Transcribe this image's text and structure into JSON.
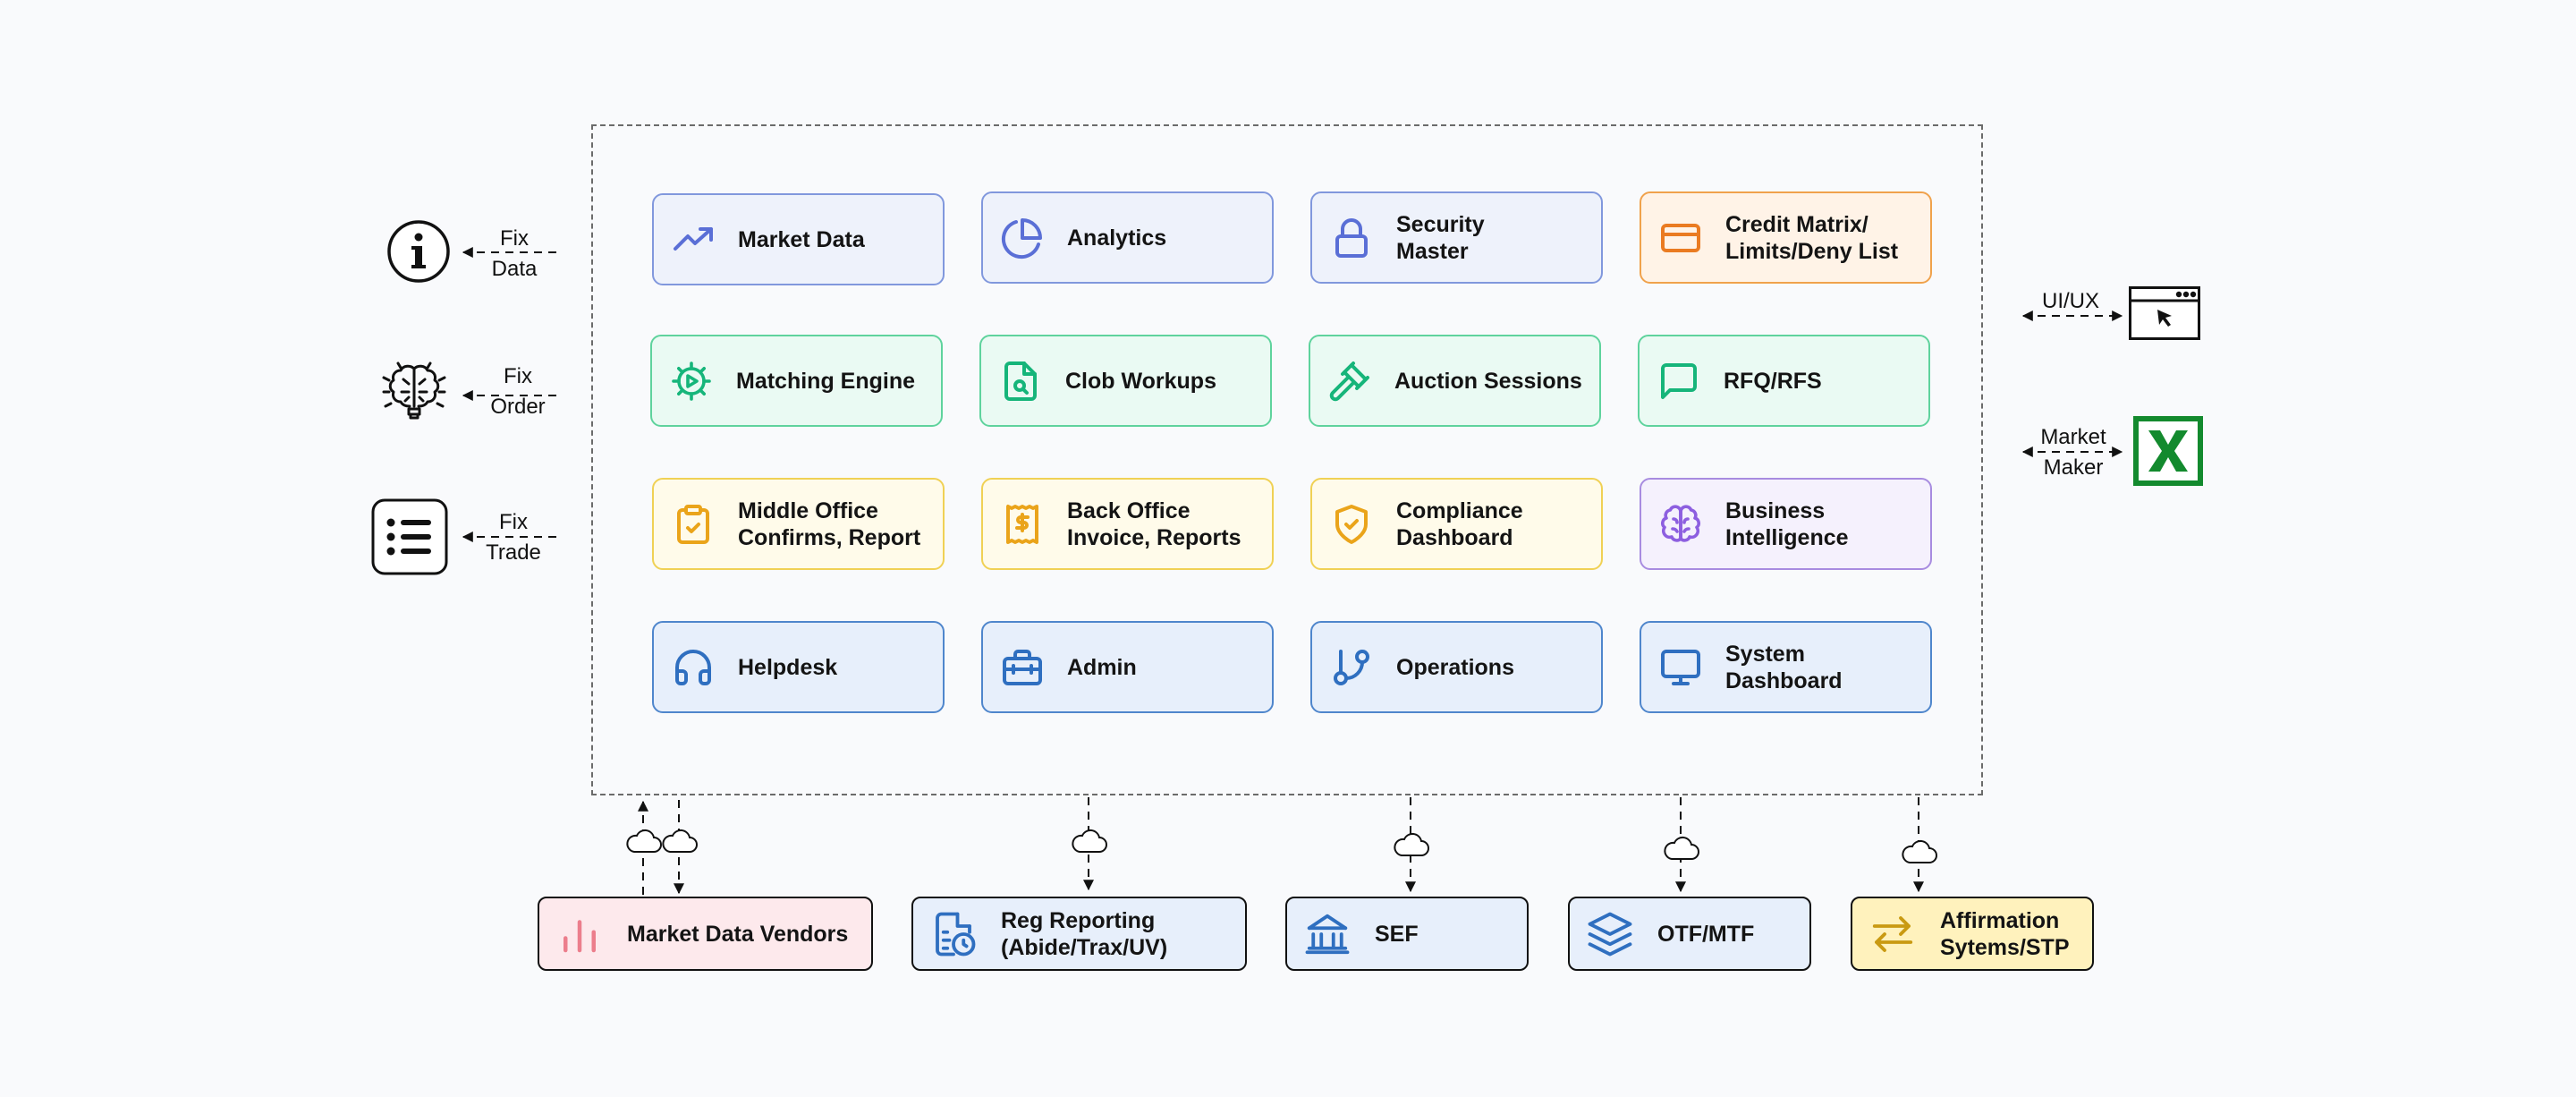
{
  "modules": [
    {
      "id": "market-data",
      "label": "Market Data",
      "icon": "trending-up-icon",
      "color": "#5a6fd6"
    },
    {
      "id": "analytics",
      "label": "Analytics",
      "icon": "pie-chart-icon",
      "color": "#5a6fd6"
    },
    {
      "id": "security-master",
      "label": "Security\nMaster",
      "icon": "lock-icon",
      "color": "#5a6fd6"
    },
    {
      "id": "credit-matrix",
      "label": "Credit Matrix/\nLimits/Deny List",
      "icon": "credit-card-icon",
      "color": "#ea7b22"
    },
    {
      "id": "matching-engine",
      "label": "Matching Engine",
      "icon": "cog-play-icon",
      "color": "#16b57a"
    },
    {
      "id": "clob-workups",
      "label": "Clob Workups",
      "icon": "file-search-icon",
      "color": "#16b57a"
    },
    {
      "id": "auction-sessions",
      "label": "Auction Sessions",
      "icon": "gavel-icon",
      "color": "#16b57a"
    },
    {
      "id": "rfq-rfs",
      "label": "RFQ/RFS",
      "icon": "message-square-icon",
      "color": "#16b57a"
    },
    {
      "id": "middle-office",
      "label": "Middle Office\nConfirms, Report",
      "icon": "clipboard-check-icon",
      "color": "#eaa41a"
    },
    {
      "id": "back-office",
      "label": "Back Office\nInvoice, Reports",
      "icon": "receipt-dollar-icon",
      "color": "#eaa41a"
    },
    {
      "id": "compliance-dashboard",
      "label": "Compliance\nDashboard",
      "icon": "shield-check-icon",
      "color": "#eaa41a"
    },
    {
      "id": "business-intelligence",
      "label": "Business\nIntelligence",
      "icon": "brain-icon",
      "color": "#8d5fe0"
    },
    {
      "id": "helpdesk",
      "label": "Helpdesk",
      "icon": "headphones-icon",
      "color": "#2f6fc0"
    },
    {
      "id": "admin",
      "label": "Admin",
      "icon": "toolbox-icon",
      "color": "#2f6fc0"
    },
    {
      "id": "operations",
      "label": "Operations",
      "icon": "git-branch-icon",
      "color": "#2f6fc0"
    },
    {
      "id": "system-dashboard",
      "label": "System\nDashboard",
      "icon": "monitor-icon",
      "color": "#2f6fc0"
    }
  ],
  "externals": [
    {
      "id": "market-data-vendors",
      "label": "Market Data Vendors",
      "icon": "bar-chart-icon",
      "color": "#ec7e8c"
    },
    {
      "id": "reg-reporting",
      "label": "Reg Reporting\n(Abide/Trax/UV)",
      "icon": "file-clock-icon",
      "color": "#2f6fc0"
    },
    {
      "id": "sef",
      "label": "SEF",
      "icon": "bank-icon",
      "color": "#2f6fc0"
    },
    {
      "id": "otf-mtf",
      "label": "OTF/MTF",
      "icon": "layers-icon",
      "color": "#2f6fc0"
    },
    {
      "id": "affirmation",
      "label": "Affirmation\nSytems/STP",
      "icon": "arrows-left-right-icon",
      "color": "#c99a12"
    }
  ],
  "left_inputs": [
    {
      "id": "fix-data",
      "label": "Fix\nData",
      "icon": "info-circle-icon"
    },
    {
      "id": "fix-order",
      "label": "Fix\nOrder",
      "icon": "brain-circuit-icon"
    },
    {
      "id": "fix-trade",
      "label": "Fix\nTrade",
      "icon": "list-icon"
    }
  ],
  "right_outputs": [
    {
      "id": "ui-ux",
      "label": "UI/UX",
      "icon": "browser-window-icon"
    },
    {
      "id": "market-maker",
      "label": "Market\nMaker",
      "icon": "excel-icon",
      "color": "#138a2e"
    }
  ]
}
